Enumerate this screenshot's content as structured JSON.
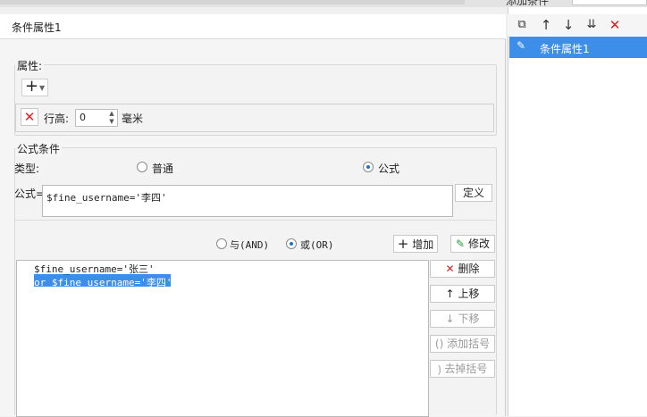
{
  "top": {
    "tab_label": "添加条件",
    "menu_glyph": "⋯"
  },
  "left": {
    "title": "条件属性1",
    "attr_group_label": "属性:",
    "add_icon_glyph": "+",
    "row": {
      "remove_glyph": "✕",
      "label": "行高:",
      "value": "0",
      "unit": "毫米"
    },
    "formula_group_label": "公式条件",
    "type_label": "类型:",
    "type_options": [
      {
        "label": "普通",
        "selected": false
      },
      {
        "label": "公式",
        "selected": true
      }
    ],
    "formula_label": "公式=",
    "formula_value": "$fine_username='李四'",
    "define_button": "定义",
    "logic_options": [
      {
        "label": "与(AND)",
        "selected": false
      },
      {
        "label": "或(OR)",
        "selected": true
      }
    ],
    "add_button": "增加",
    "edit_button": "修改",
    "conditions": [
      {
        "text": "$fine_username='张三'",
        "selected": false
      },
      {
        "text": "or  $fine_username='李四'",
        "selected": true
      }
    ],
    "side_buttons": [
      {
        "label": "删除",
        "icon": "✕",
        "enabled": true
      },
      {
        "label": "上移",
        "icon": "🡑",
        "enabled": true
      },
      {
        "label": "下移",
        "icon": "🡓",
        "enabled": false
      },
      {
        "label": "添加括号",
        "icon": "()",
        "enabled": false
      },
      {
        "label": "去掉括号",
        "icon": "⟯",
        "enabled": false
      }
    ]
  },
  "right": {
    "item_label": "条件属性1"
  },
  "colors": {
    "selection": "#3d8ee8",
    "delete_red": "#e02020"
  }
}
